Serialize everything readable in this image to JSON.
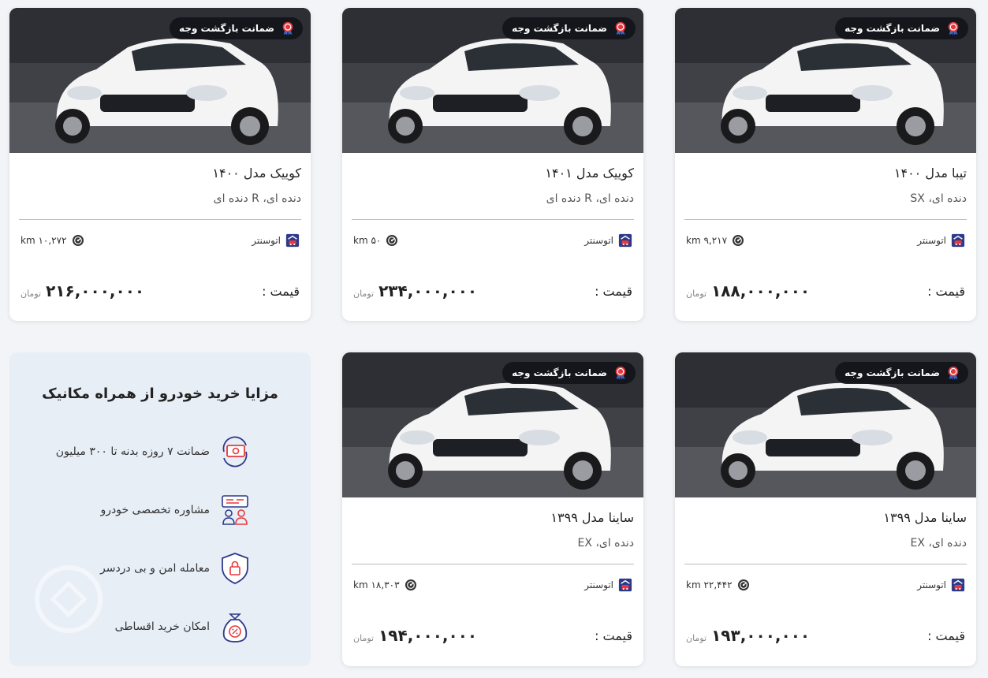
{
  "badge_label": "ضمانت بازگشت وجه",
  "price_label": "قیمت :",
  "currency": "تومان",
  "cars": [
    {
      "title": "تیبا مدل ۱۴۰۰",
      "spec": "دنده ای، SX",
      "location": "اتوسنتر",
      "km": "۹,۲۱۷ km",
      "price": "۱۸۸,۰۰۰,۰۰۰"
    },
    {
      "title": "کوییک مدل ۱۴۰۱",
      "spec": "دنده ای، R دنده ای",
      "location": "اتوسنتر",
      "km": "۵۰ km",
      "price": "۲۳۴,۰۰۰,۰۰۰"
    },
    {
      "title": "کوییک مدل ۱۴۰۰",
      "spec": "دنده ای، R دنده ای",
      "location": "اتوسنتر",
      "km": "۱۰,۲۷۲ km",
      "price": "۲۱۶,۰۰۰,۰۰۰"
    },
    {
      "title": "ساینا مدل ۱۳۹۹",
      "spec": "دنده ای، EX",
      "location": "اتوسنتر",
      "km": "۲۲,۴۴۲ km",
      "price": "۱۹۳,۰۰۰,۰۰۰"
    },
    {
      "title": "ساینا مدل ۱۳۹۹",
      "spec": "دنده ای، EX",
      "location": "اتوسنتر",
      "km": "۱۸,۳۰۳ km",
      "price": "۱۹۴,۰۰۰,۰۰۰"
    }
  ],
  "benefits": {
    "title": "مزایا خرید خودرو از همراه مکانیک",
    "items": [
      {
        "icon": "money-guarantee-icon",
        "label": "ضمانت ۷ روزه بدنه تا ۳۰۰ میلیون"
      },
      {
        "icon": "consultation-icon",
        "label": "مشاوره تخصصی خودرو"
      },
      {
        "icon": "secure-shield-icon",
        "label": "معامله امن و بی دردسر"
      },
      {
        "icon": "installment-bag-icon",
        "label": "امکان خرید اقساطی"
      }
    ]
  },
  "colors": {
    "badge_bg": "#14141a",
    "icon_blue": "#2d3a8c",
    "icon_red": "#e5393d",
    "benefits_bg": "#e8eef6"
  }
}
